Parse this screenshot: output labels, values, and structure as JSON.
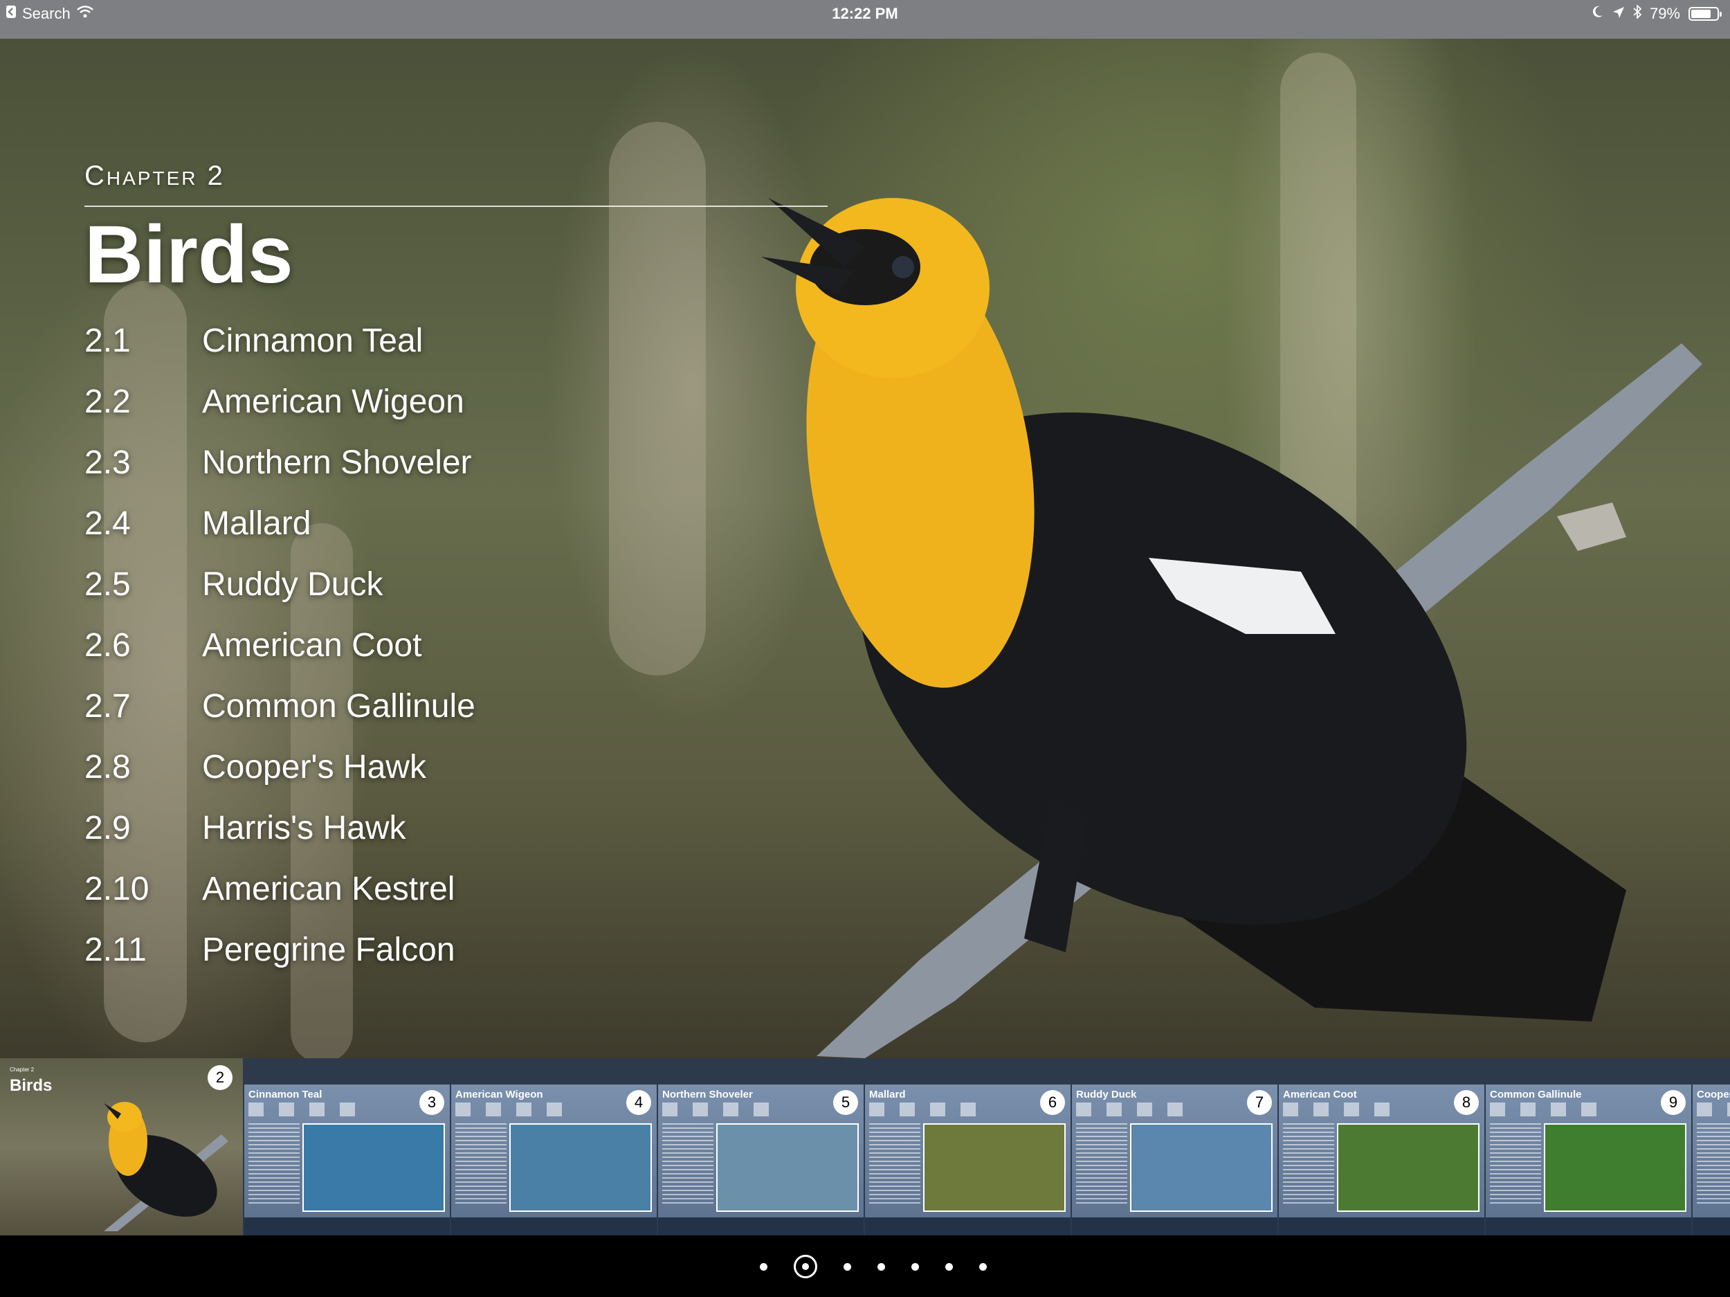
{
  "status_bar": {
    "back_label": "Search",
    "time": "12:22 PM",
    "battery": "79%",
    "battery_level": 0.79,
    "icons": [
      "back-arrow-icon",
      "wifi-icon",
      "moon-icon",
      "location-icon",
      "bluetooth-icon",
      "battery-icon"
    ]
  },
  "chapter": {
    "label": "Chapter 2",
    "title": "Birds",
    "sections": [
      {
        "num": "2.1",
        "name": "Cinnamon Teal"
      },
      {
        "num": "2.2",
        "name": "American Wigeon"
      },
      {
        "num": "2.3",
        "name": "Northern Shoveler"
      },
      {
        "num": "2.4",
        "name": "Mallard"
      },
      {
        "num": "2.5",
        "name": "Ruddy Duck"
      },
      {
        "num": "2.6",
        "name": "American Coot"
      },
      {
        "num": "2.7",
        "name": "Common Gallinule"
      },
      {
        "num": "2.8",
        "name": "Cooper's Hawk"
      },
      {
        "num": "2.9",
        "name": "Harris's Hawk"
      },
      {
        "num": "2.10",
        "name": "American Kestrel"
      },
      {
        "num": "2.11",
        "name": "Peregrine Falcon"
      }
    ]
  },
  "thumbnails": {
    "current": {
      "mini_chapter": "Chapter 2",
      "title": "Birds",
      "page": "2"
    },
    "pages": [
      {
        "title": "Cinnamon Teal",
        "page": "3",
        "photo_color": "#3a7aa8"
      },
      {
        "title": "American Wigeon",
        "page": "4",
        "photo_color": "#4a80a6"
      },
      {
        "title": "Northern Shoveler",
        "page": "5",
        "photo_color": "#6a90aa"
      },
      {
        "title": "Mallard",
        "page": "6",
        "photo_color": "#6d7a3c"
      },
      {
        "title": "Ruddy Duck",
        "page": "7",
        "photo_color": "#5b86ae"
      },
      {
        "title": "American Coot",
        "page": "8",
        "photo_color": "#4d7a32"
      },
      {
        "title": "Common Gallinule",
        "page": "9",
        "photo_color": "#3f7e2e"
      },
      {
        "title": "Cooper's",
        "page": "",
        "photo_color": "#6a86a8"
      }
    ]
  },
  "page_dots": {
    "count": 7,
    "current_index": 1
  }
}
